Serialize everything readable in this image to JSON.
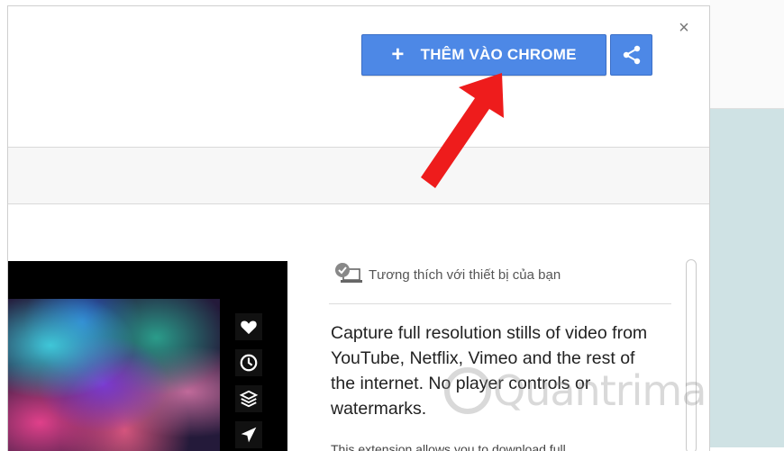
{
  "dialog": {
    "add_button_label": "THÊM VÀO CHROME",
    "add_button_icon": "plus-icon",
    "share_button_icon": "share-icon",
    "close_symbol": "×"
  },
  "sidebar_icons": [
    "heart-icon",
    "clock-icon",
    "layers-icon",
    "send-icon"
  ],
  "info": {
    "compatibility": "Tương thích với thiết bị của bạn",
    "description": "Capture full resolution stills of video from YouTube, Netflix, Vimeo and the rest of the internet. No player controls or watermarks.",
    "description_more": "This extension allows you to download full"
  },
  "watermark": {
    "text": "Quantrimang"
  },
  "colors": {
    "button_blue": "#4d88e6",
    "arrow_red": "#ee1c1c"
  }
}
